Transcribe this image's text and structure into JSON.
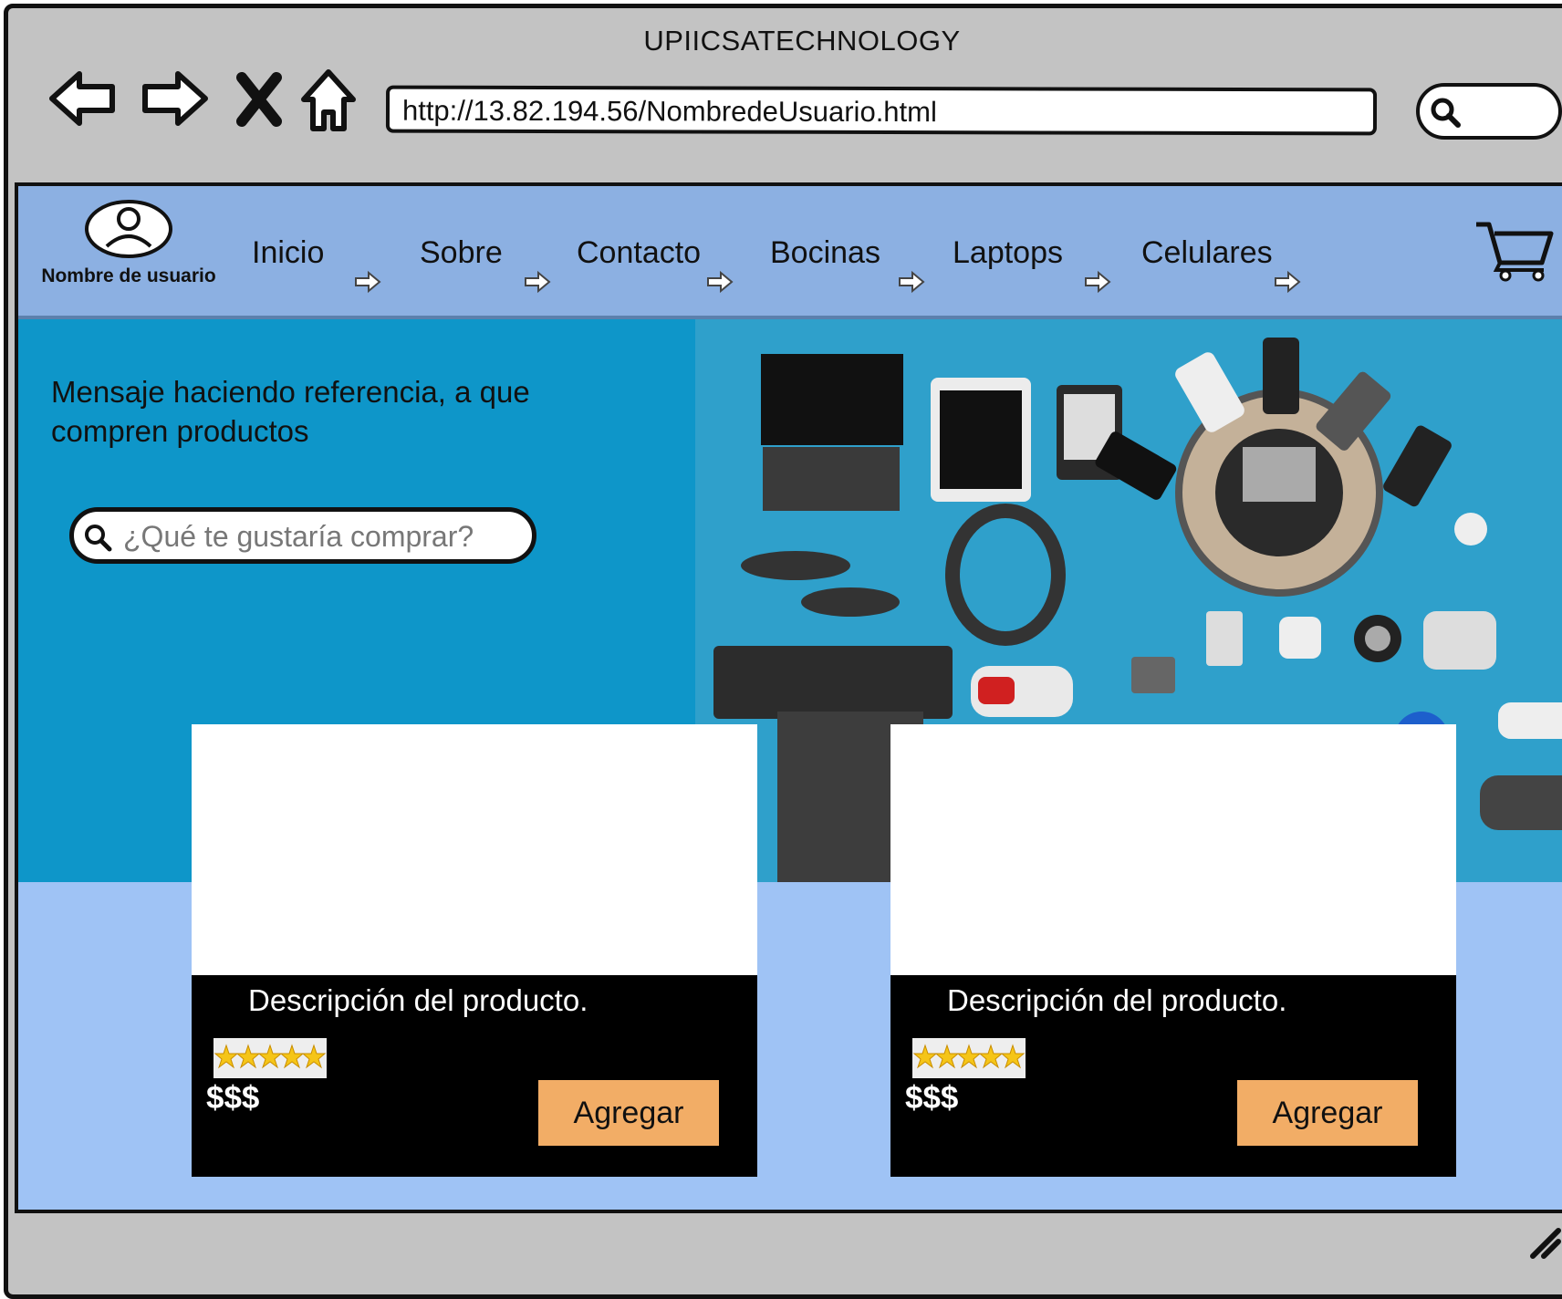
{
  "window": {
    "title": "UPIICSATECHNOLOGY"
  },
  "browser": {
    "url": "http://13.82.194.56/NombredeUsuario.html"
  },
  "nav": {
    "user_label": "Nombre de usuario",
    "items": [
      {
        "label": "Inicio"
      },
      {
        "label": "Sobre"
      },
      {
        "label": "Contacto"
      },
      {
        "label": "Bocinas"
      },
      {
        "label": "Laptops"
      },
      {
        "label": "Celulares"
      }
    ]
  },
  "hero": {
    "message": "Mensaje haciendo referencia, a que compren productos",
    "search_placeholder": "¿Qué te gustaría comprar?"
  },
  "products": [
    {
      "description": "Descripción del producto.",
      "rating": 5,
      "price": "$$$",
      "button_label": "Agregar"
    },
    {
      "description": "Descripción del producto.",
      "rating": 5,
      "price": "$$$",
      "button_label": "Agregar"
    }
  ]
}
